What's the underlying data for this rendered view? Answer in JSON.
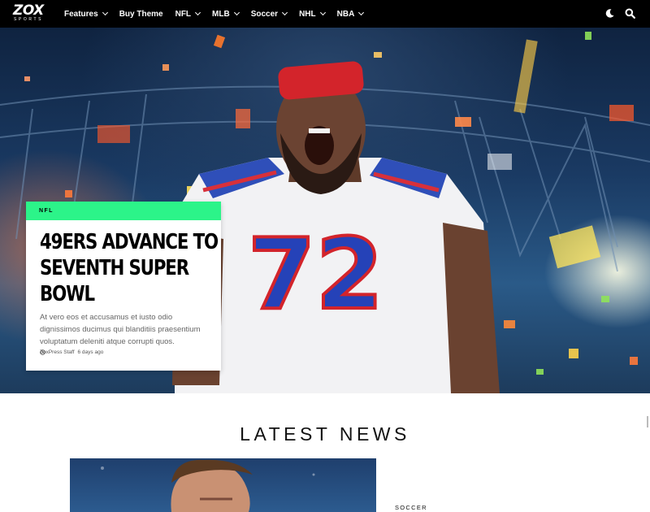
{
  "brand": {
    "name": "ZOX",
    "tagline": "SPORTS"
  },
  "nav": {
    "items": [
      {
        "label": "Features",
        "has_dropdown": true
      },
      {
        "label": "Buy Theme",
        "has_dropdown": false
      },
      {
        "label": "NFL",
        "has_dropdown": true
      },
      {
        "label": "MLB",
        "has_dropdown": true
      },
      {
        "label": "Soccer",
        "has_dropdown": true
      },
      {
        "label": "NHL",
        "has_dropdown": true
      },
      {
        "label": "NBA",
        "has_dropdown": true
      }
    ],
    "icons": [
      "moon-icon",
      "search-icon"
    ]
  },
  "hero": {
    "category": "NFL",
    "title": "49ERS ADVANCE TO SEVENTH SUPER BOWL",
    "excerpt": "At vero eos et accusamus et iusto odio dignissimos ducimus qui blanditiis praesentium voluptatum deleniti atque corrupti quos.",
    "author": "ZoxPress Staff",
    "time_ago": "6 days ago",
    "jersey_number": "72"
  },
  "latest": {
    "heading": "LATEST NEWS",
    "first_item_category": "SOCCER"
  },
  "colors": {
    "nav_bg": "#000000",
    "accent_green": "#2cf489",
    "text_dark": "#111111",
    "jersey_blue": "#1f3fb0",
    "headband_red": "#d3242b"
  }
}
